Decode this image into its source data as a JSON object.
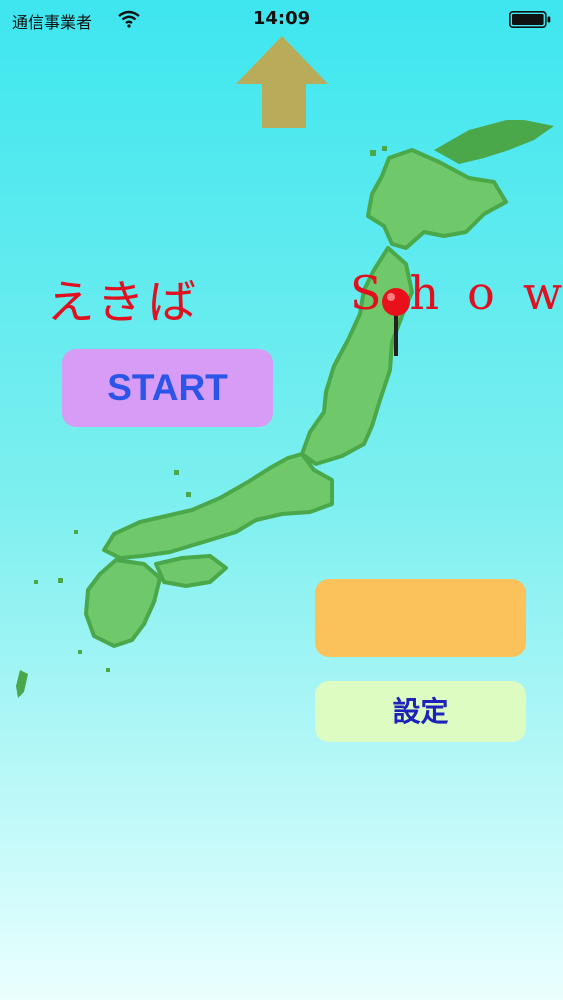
{
  "status_bar": {
    "carrier": "通信事業者",
    "time": "14:09"
  },
  "title": {
    "japanese": "えきば",
    "english": "Show"
  },
  "buttons": {
    "start_label": "START",
    "orange_label": "",
    "settings_label": "設定"
  },
  "icons": {
    "wifi": "wifi-icon",
    "battery": "battery-icon",
    "up_arrow": "up-arrow-icon",
    "map_pin": "map-pin-icon"
  },
  "colors": {
    "background_top": "#3ee6ef",
    "start_button": "#d79cf5",
    "start_text": "#2a55e8",
    "orange_button": "#fbc15a",
    "settings_button": "#ddfcc1",
    "settings_text": "#1d22b8",
    "title_red": "#e01020",
    "arrow": "#b8ac5a",
    "map_green": "#6fc96a"
  }
}
